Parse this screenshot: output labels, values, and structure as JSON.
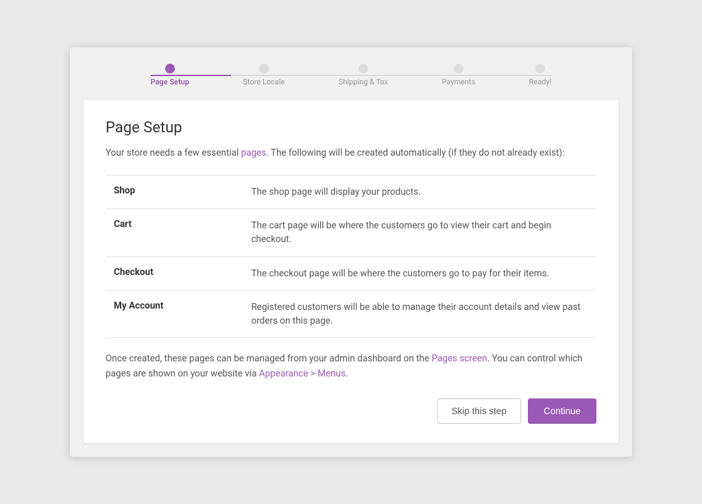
{
  "stepper": {
    "items": [
      {
        "label": "Page Setup",
        "active": true
      },
      {
        "label": "Store Locale",
        "active": false
      },
      {
        "label": "Shipping & Tax",
        "active": false
      },
      {
        "label": "Payments",
        "active": false
      },
      {
        "label": "Ready!",
        "active": false
      }
    ]
  },
  "card": {
    "title": "Page Setup",
    "description_part1": "Your store needs a few essential ",
    "description_link": "pages",
    "description_part2": ". The following will be created automatically (if they do not already exist):",
    "pages": [
      {
        "name": "Shop",
        "description": "The shop page will display your products."
      },
      {
        "name": "Cart",
        "description": "The cart page will be where the customers go to view their cart and begin checkout."
      },
      {
        "name": "Checkout",
        "description": "The checkout page will be where the customers go to pay for their items."
      },
      {
        "name": "My Account",
        "description": "Registered customers will be able to manage their account details and view past orders on this page."
      }
    ],
    "footer_part1": "Once created, these pages can be managed from your admin dashboard on the ",
    "footer_link1": "Pages screen",
    "footer_part2": ". You can control which pages are shown on your website via ",
    "footer_link2": "Appearance > Menus",
    "footer_part3": "."
  },
  "buttons": {
    "skip_label": "Skip this step",
    "continue_label": "Continue"
  }
}
